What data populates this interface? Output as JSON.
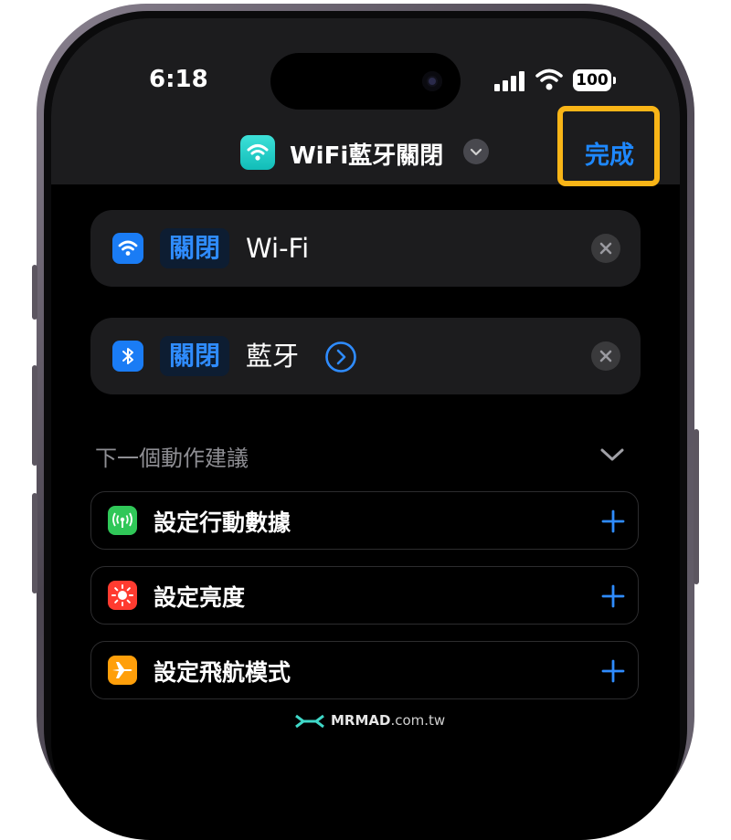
{
  "status_bar": {
    "time": "6:18",
    "battery": "100"
  },
  "nav": {
    "title": "WiFi藍牙關閉",
    "done_label": "完成"
  },
  "actions": [
    {
      "verb": "關閉",
      "object": "Wi-Fi",
      "icon": "wifi-icon",
      "color": "#1a7cf5"
    },
    {
      "verb": "關閉",
      "object": "藍牙",
      "icon": "bluetooth-icon",
      "color": "#1a7cf5"
    }
  ],
  "suggestions": {
    "header": "下一個動作建議",
    "items": [
      {
        "label": "設定行動數據",
        "icon": "cellular-icon",
        "color": "#30c758"
      },
      {
        "label": "設定亮度",
        "icon": "brightness-icon",
        "color": "#ff3b30"
      },
      {
        "label": "設定飛航模式",
        "icon": "airplane-icon",
        "color": "#ff9f0a"
      }
    ]
  },
  "watermark": {
    "brand": "MRMAD",
    "domain": ".com.tw"
  },
  "colors": {
    "accent": "#1e88ff",
    "highlight": "#f9b517"
  }
}
